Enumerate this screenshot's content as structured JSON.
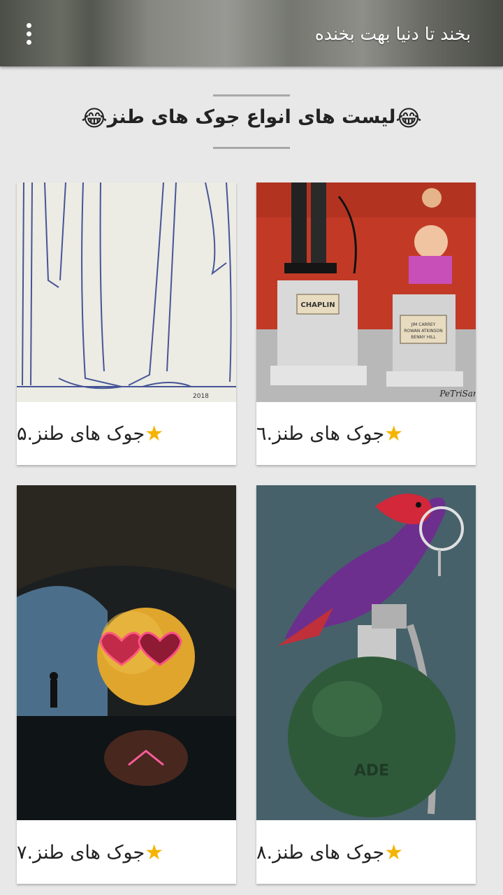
{
  "appbar": {
    "title": "بخند تا دنیا بهت بخنده",
    "menu_icon": "more-vert-icon"
  },
  "heading": {
    "text": "لیست های انواع جوک های طنز",
    "emoji": "😂"
  },
  "cards": [
    {
      "label": "جوک های طنز.٦",
      "image": "statue-chaplin-caricature"
    },
    {
      "label": "جوک های طنز.۵",
      "image": "pencil-sketch-legs"
    },
    {
      "label": "جوک های طنز.۸",
      "image": "bird-on-grenade"
    },
    {
      "label": "جوک های طنز.۷",
      "image": "heart-eyes-emoji-cave"
    }
  ],
  "icons": {
    "star": "star-icon",
    "infinity": "infinity-icon"
  }
}
